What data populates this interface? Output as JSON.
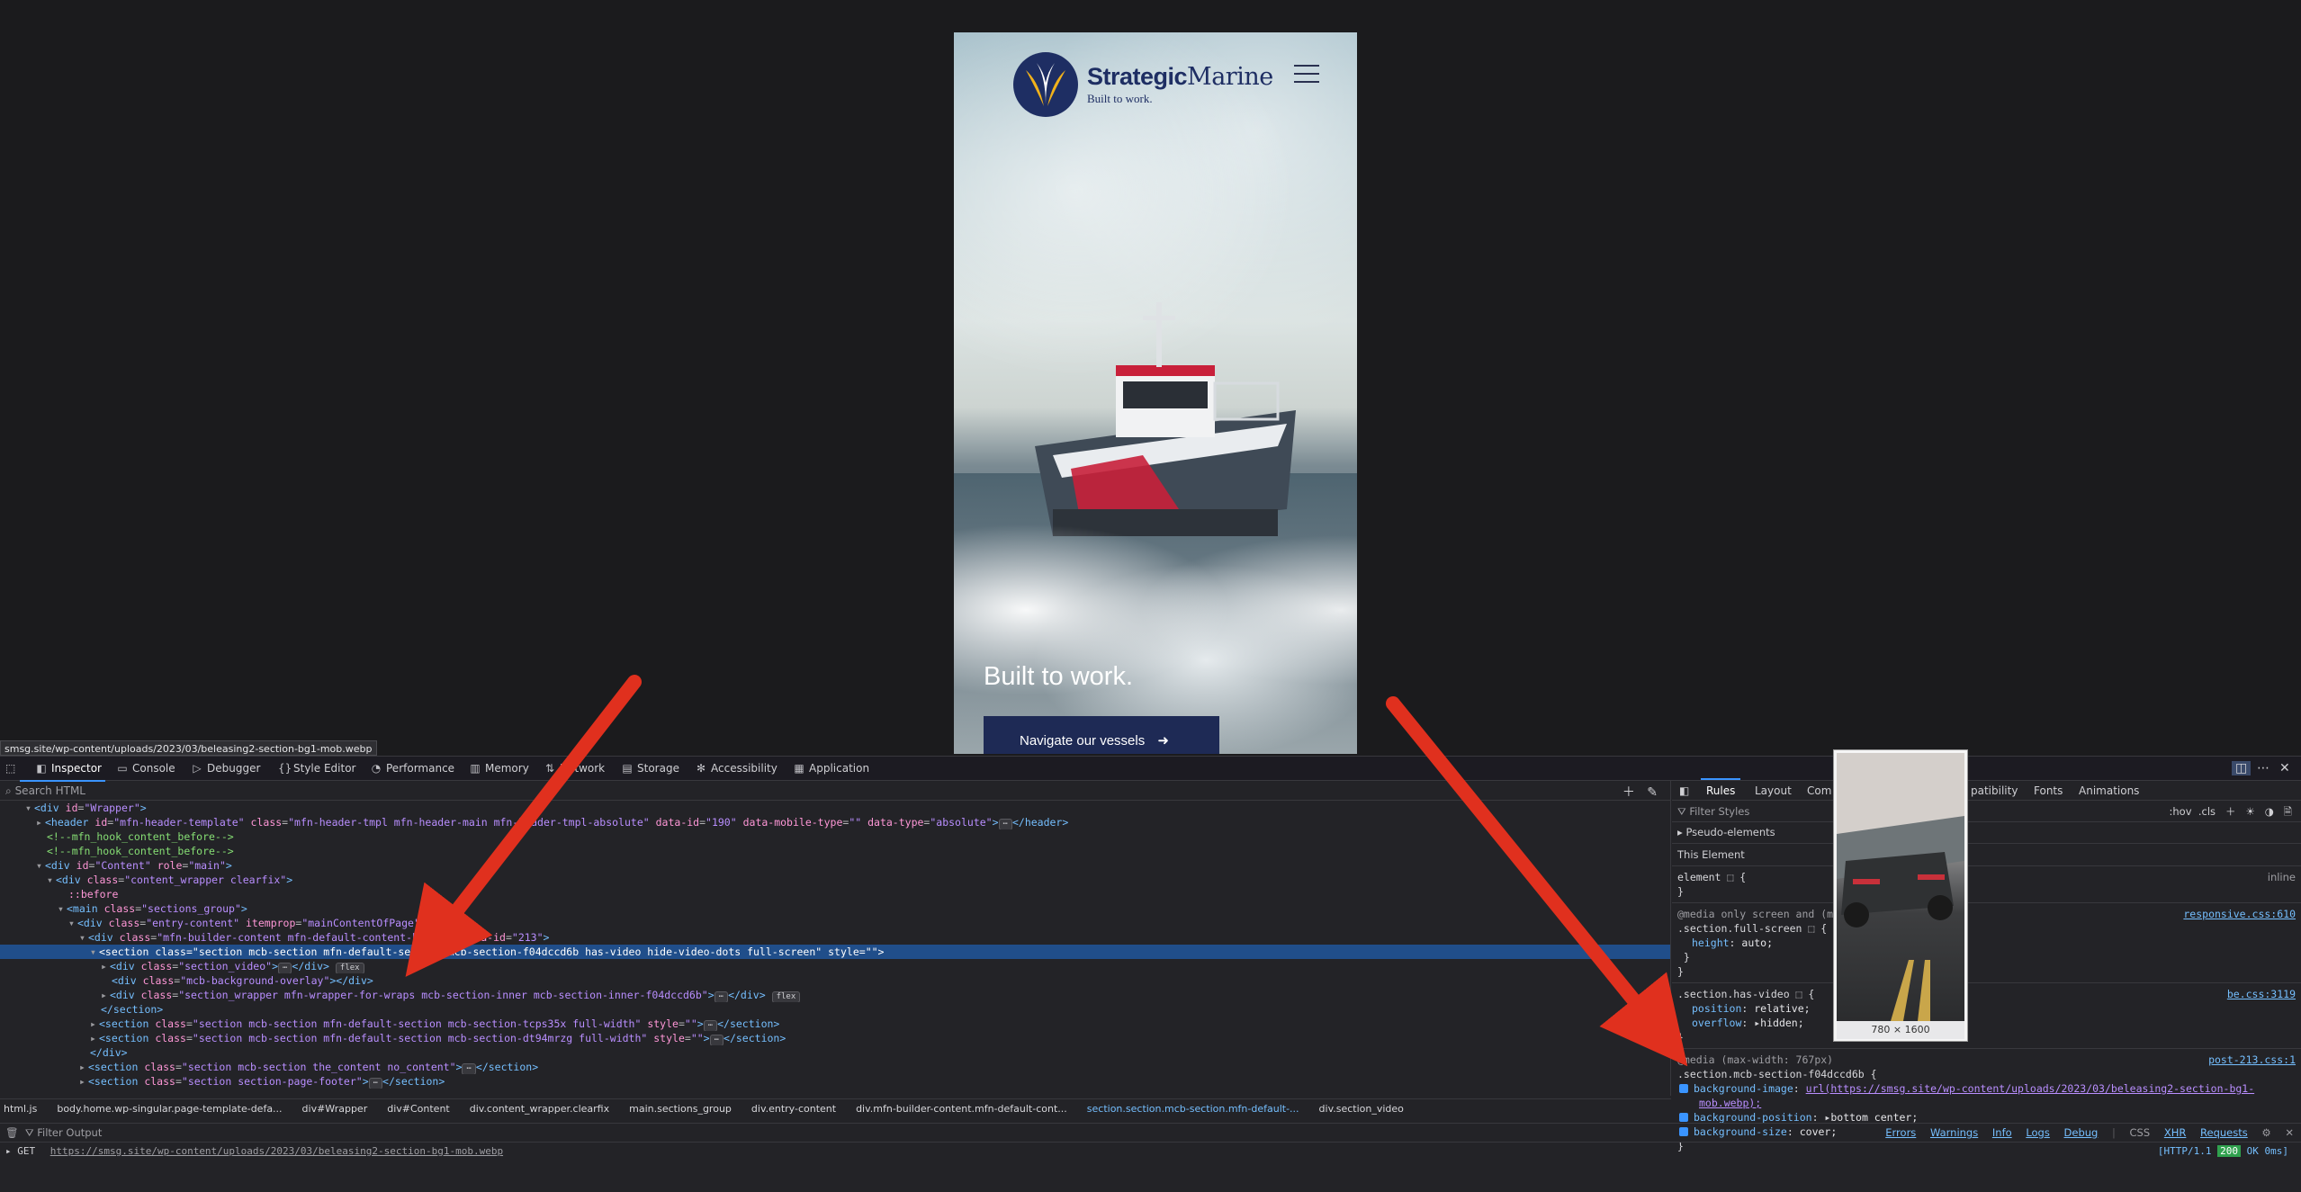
{
  "page": {
    "brand_bold": "Strategic",
    "brand_regular": "Marine",
    "tagline": "Built to work.",
    "hero_title": "Built to work.",
    "cta_label": "Navigate our vessels",
    "cta_arrow": "➜"
  },
  "url_tooltip": "smsg.site/wp-content/uploads/2023/03/beleasing2-section-bg1-mob.webp",
  "devtools": {
    "tabs": [
      {
        "label": "Inspector",
        "icon": "inspector-icon"
      },
      {
        "label": "Console",
        "icon": "console-icon"
      },
      {
        "label": "Debugger",
        "icon": "debugger-icon"
      },
      {
        "label": "Style Editor",
        "icon": "style-editor-icon"
      },
      {
        "label": "Performance",
        "icon": "performance-icon"
      },
      {
        "label": "Memory",
        "icon": "memory-icon"
      },
      {
        "label": "Network",
        "icon": "network-icon"
      },
      {
        "label": "Storage",
        "icon": "storage-icon"
      },
      {
        "label": "Accessibility",
        "icon": "accessibility-icon"
      },
      {
        "label": "Application",
        "icon": "application-icon"
      }
    ],
    "search_placeholder": "Search HTML",
    "markup": [
      {
        "html": "<span class='tw'>▾</span><span class='t'>&lt;div</span> <span class='a'>id</span>=<span class='v'>\"Wrapper\"</span><span class='t'>&gt;</span>",
        "indent": 1
      },
      {
        "html": "<span class='tw'>▸</span><span class='t'>&lt;header</span> <span class='a'>id</span>=<span class='v'>\"mfn-header-template\"</span> <span class='a'>class</span>=<span class='v'>\"mfn-header-tmpl mfn-header-main mfn-header-tmpl-absolute\"</span> <span class='a'>data-id</span>=<span class='v'>\"190\"</span> <span class='a'>data-mobile-type</span>=<span class='v'>\"\"</span> <span class='a'>data-type</span>=<span class='v'>\"absolute\"</span><span class='t'>&gt;</span><span class='badge'>⋯</span><span class='t'>&lt;/header&gt;</span>",
        "indent": 2
      },
      {
        "html": "<span class='c'>&lt;!--mfn_hook_content_before--&gt;</span>",
        "indent": 3
      },
      {
        "html": "<span class='c'>&lt;!--mfn_hook_content_before--&gt;</span>",
        "indent": 3
      },
      {
        "html": "<span class='tw'>▾</span><span class='t'>&lt;div</span> <span class='a'>id</span>=<span class='v'>\"Content\"</span> <span class='a'>role</span>=<span class='v'>\"main\"</span><span class='t'>&gt;</span>",
        "indent": 2
      },
      {
        "html": "<span class='tw'>▾</span><span class='t'>&lt;div</span> <span class='a'>class</span>=<span class='v'>\"content_wrapper clearfix\"</span><span class='t'>&gt;</span>",
        "indent": 3
      },
      {
        "html": "<span class='pseudo'>::before</span>",
        "indent": 5
      },
      {
        "html": "<span class='tw'>▾</span><span class='t'>&lt;main</span> <span class='a'>class</span>=<span class='v'>\"sections_group\"</span><span class='t'>&gt;</span>",
        "indent": 4
      },
      {
        "html": "<span class='tw'>▾</span><span class='t'>&lt;div</span> <span class='a'>class</span>=<span class='v'>\"entry-content\"</span> <span class='a'>itemprop</span>=<span class='v'>\"mainContentOfPage\"</span><span class='t'>&gt;</span>",
        "indent": 5
      },
      {
        "html": "<span class='tw'>▾</span><span class='t'>&lt;div</span> <span class='a'>class</span>=<span class='v'>\"mfn-builder-content mfn-default-content-buider\"</span> <span class='a'>data-id</span>=<span class='v'>\"213\"</span><span class='t'>&gt;</span>",
        "indent": 6
      },
      {
        "html": "<span class='tw'>▾</span><span class='t'>&lt;section</span> <span class='a'>class</span>=<span class='v'>\"section mcb-section mfn-default-section mcb-section-f04dccd6b has-video hide-video-dots full-screen\"</span> <span class='a'>style</span>=<span class='v'>\"\"</span><span class='t'>&gt;</span>",
        "indent": 7,
        "selected": true
      },
      {
        "html": "<span class='tw'>▸</span><span class='t'>&lt;div</span> <span class='a'>class</span>=<span class='v'>\"section_video\"</span><span class='t'>&gt;</span><span class='badge'>⋯</span><span class='t'>&lt;/div&gt;</span> <span class='badge'>flex</span>",
        "indent": 8
      },
      {
        "html": "<span class='t'>&lt;div</span> <span class='a'>class</span>=<span class='v'>\"mcb-background-overlay\"</span><span class='t'>&gt;&lt;/div&gt;</span>",
        "indent": 9
      },
      {
        "html": "<span class='tw'>▸</span><span class='t'>&lt;div</span> <span class='a'>class</span>=<span class='v'>\"section_wrapper mfn-wrapper-for-wraps mcb-section-inner mcb-section-inner-f04dccd6b\"</span><span class='t'>&gt;</span><span class='badge'>⋯</span><span class='t'>&lt;/div&gt;</span> <span class='badge'>flex</span>",
        "indent": 8
      },
      {
        "html": "<span class='t'>&lt;/section&gt;</span>",
        "indent": 8
      },
      {
        "html": "<span class='tw'>▸</span><span class='t'>&lt;section</span> <span class='a'>class</span>=<span class='v'>\"section mcb-section mfn-default-section mcb-section-tcps35x full-width\"</span> <span class='a'>style</span>=<span class='v'>\"\"</span><span class='t'>&gt;</span><span class='badge'>⋯</span><span class='t'>&lt;/section&gt;</span>",
        "indent": 7
      },
      {
        "html": "<span class='tw'>▸</span><span class='t'>&lt;section</span> <span class='a'>class</span>=<span class='v'>\"section mcb-section mfn-default-section mcb-section-dt94mrzg full-width\"</span> <span class='a'>style</span>=<span class='v'>\"\"</span><span class='t'>&gt;</span><span class='badge'>⋯</span><span class='t'>&lt;/section&gt;</span>",
        "indent": 7
      },
      {
        "html": "<span class='t'>&lt;/div&gt;</span>",
        "indent": 7
      },
      {
        "html": "<span class='tw'>▸</span><span class='t'>&lt;section</span> <span class='a'>class</span>=<span class='v'>\"section mcb-section the_content no_content\"</span><span class='t'>&gt;</span><span class='badge'>⋯</span><span class='t'>&lt;/section&gt;</span>",
        "indent": 6
      },
      {
        "html": "<span class='tw'>▸</span><span class='t'>&lt;section</span> <span class='a'>class</span>=<span class='v'>\"section section-page-footer\"</span><span class='t'>&gt;</span><span class='badge'>⋯</span><span class='t'>&lt;/section&gt;</span>",
        "indent": 6
      }
    ],
    "breadcrumbs": [
      "html.js",
      "body.home.wp-singular.page-template-defa...",
      "div#Wrapper",
      "div#Content",
      "div.content_wrapper.clearfix",
      "main.sections_group",
      "div.entry-content",
      "div.mfn-builder-content.mfn-default-cont...",
      "section.section.mcb-section.mfn-default-...",
      "div.section_video"
    ],
    "rules_tabs": [
      "Rules",
      "Layout",
      "Com",
      "patibility",
      "Fonts",
      "Animations"
    ],
    "filter_styles": "Filter Styles",
    "hov": ":hov",
    "cls": ".cls",
    "pseudo_elements": "Pseudo-elements",
    "this_element": "This Element",
    "element_rule": "element ⬚ {",
    "inline": "inline",
    "media1": "@media only screen and (ma",
    "rule1_sel": ".section.full-screen ⬚ {",
    "rule1_prop": "height",
    "rule1_val": "auto;",
    "rule1_src": "responsive.css:610",
    "rule2_sel": ".section.has-video ⬚ {",
    "rule2_src": "be.css:3119",
    "rule2_p1": "position",
    "rule2_v1": "relative;",
    "rule2_p2": "overflow",
    "rule2_v2": "hidden;",
    "media2": "@media (max-width: 767px)",
    "rule3_sel": ".section.mcb-section-f04dccd6b",
    "rule3_src": "post-213.css:1",
    "rule3_p1": "background-image",
    "rule3_v1": "url(https://smsg.site/wp-content/uploads/2023/03/beleasing2-section-bg1-",
    "rule3_v1b": "mob.webp);",
    "rule3_p2": "background-position",
    "rule3_v2": "bottom center;",
    "rule3_p3": "background-size",
    "rule3_v3": "cover;",
    "preview_caption": "780 × 1600",
    "console": {
      "filter_output": "Filter Output",
      "filters": [
        "Errors",
        "Warnings",
        "Info",
        "Logs",
        "Debug"
      ],
      "right": [
        "CSS",
        "XHR",
        "Requests"
      ],
      "method": "GET",
      "url": "https://smsg.site/wp-content/uploads/2023/03/beleasing2-section-bg1-mob.webp",
      "status_proto": "[HTTP/1.1",
      "status_code": "200",
      "status_tail": "OK 0ms]"
    }
  },
  "colors": {
    "accent": "#3a94ff",
    "brand_navy": "#1e2a55",
    "arrow_red": "#e0301e"
  }
}
